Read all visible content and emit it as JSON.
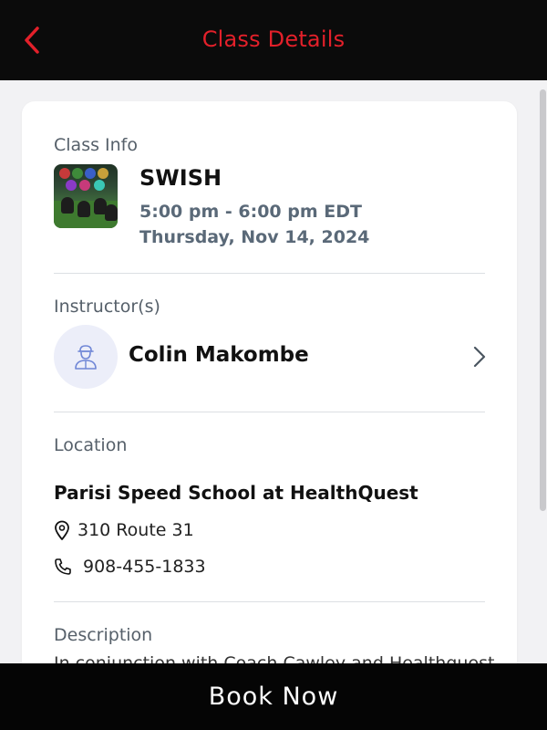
{
  "header": {
    "title": "Class Details",
    "back_icon": "chevron-left-icon",
    "accent_color": "#e3202a",
    "background": "#0b0b0b"
  },
  "class_info": {
    "section_label": "Class Info",
    "name": "SWISH",
    "time": "5:00 pm - 6:00 pm EDT",
    "date": "Thursday, Nov 14, 2024"
  },
  "instructors": {
    "section_label": "Instructor(s)",
    "items": [
      {
        "name": "Colin Makombe",
        "avatar_icon": "person-icon"
      }
    ]
  },
  "location": {
    "section_label": "Location",
    "name": "Parisi Speed School at HealthQuest",
    "address": "310 Route 31",
    "phone": "908-455-1833"
  },
  "description": {
    "section_label": "Description",
    "text": "In conjunction with Coach Cawley and Healthquest"
  },
  "footer": {
    "book_label": "Book Now"
  }
}
